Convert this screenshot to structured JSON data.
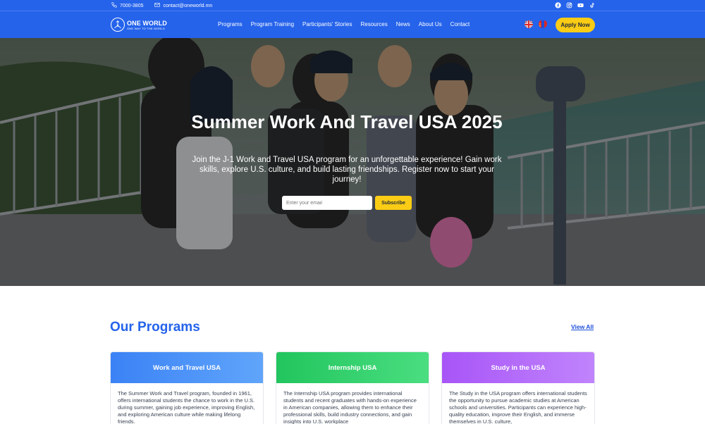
{
  "topbar": {
    "phone": "7000-3805",
    "email": "contact@oneworld.mn",
    "socials": [
      "facebook-icon",
      "instagram-icon",
      "youtube-icon",
      "tiktok-icon"
    ]
  },
  "logo": {
    "brand": "ONE WORLD",
    "tagline": "ONE WAY TO THE WORLD"
  },
  "nav": {
    "items": [
      "Programs",
      "Program Training",
      "Participants' Stories",
      "Resources",
      "News",
      "About Us",
      "Contact"
    ],
    "apply_label": "Apply Now",
    "languages": [
      "uk-flag-icon",
      "mongolia-flag-icon"
    ]
  },
  "hero": {
    "title": "Summer Work And Travel USA 2025",
    "subtitle": "Join the J-1 Work and Travel USA program for an unforgettable experience! Gain work skills, explore U.S. culture, and build lasting friendships. Register now to start your journey!",
    "email_placeholder": "Enter your email",
    "subscribe_label": "Subscribe"
  },
  "programs": {
    "title": "Our Programs",
    "view_all": "View All",
    "cards": [
      {
        "title": "Work and Travel USA",
        "description": "The Summer Work and Travel program, founded in 1961, offers international students the chance to work in the U.S. during summer, gaining job experience, improving English, and exploring American culture while making lifelong friends."
      },
      {
        "title": "Internship USA",
        "description": "The Internship USA program provides international students and recent graduates with hands-on experience in American companies, allowing them to enhance their professional skills, build industry connections, and gain insights into U.S. workplace"
      },
      {
        "title": "Study in the USA",
        "description": "The Study in the USA program offers international students the opportunity to pursue academic studies at American schools and universities. Participants can experience high-quality education, improve their English, and immerse themselves in U.S. culture,"
      }
    ]
  },
  "colors": {
    "primary": "#2563eb",
    "accent": "#facc15",
    "card_blue": "#3b82f6",
    "card_green": "#22c55e",
    "card_purple": "#a855f7"
  }
}
